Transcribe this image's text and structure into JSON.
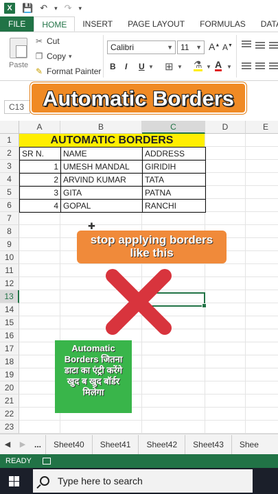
{
  "app": {
    "logo": "X",
    "tabs": [
      "FILE",
      "HOME",
      "INSERT",
      "PAGE LAYOUT",
      "FORMULAS",
      "DATA"
    ]
  },
  "ribbon": {
    "paste_label": "Paste",
    "cut_label": "Cut",
    "copy_label": "Copy",
    "format_painter_label": "Format Painter",
    "font_name": "Calibri",
    "font_size": "11",
    "bold": "B",
    "italic": "I",
    "underline": "U"
  },
  "formula_bar": {
    "name_box": "C13"
  },
  "overlay": {
    "banner": "Automatic Borders",
    "bubble_line1": "stop applying borders",
    "bubble_line2": "like this",
    "hindi_lines": [
      "Automatic",
      "Borders जितना",
      "डाटा का एंट्री करेंगे",
      "खुद ब खुद बॉर्डर",
      "मिलेगा"
    ]
  },
  "sheet": {
    "columns": [
      "A",
      "B",
      "C",
      "D",
      "E"
    ],
    "selected_column": "C",
    "rows": [
      "1",
      "2",
      "3",
      "4",
      "5",
      "6",
      "7",
      "8",
      "9",
      "10",
      "11",
      "12",
      "13",
      "14",
      "15",
      "16",
      "17",
      "18",
      "19",
      "20",
      "21",
      "22",
      "23"
    ],
    "selected_row": "13",
    "title": "AUTOMATIC BORDERS",
    "headers": [
      "SR N.",
      "NAME",
      "ADDRESS"
    ],
    "data": [
      {
        "sr": "1",
        "name": "UMESH MANDAL",
        "address": "GIRIDIH"
      },
      {
        "sr": "2",
        "name": "ARVIND KUMAR",
        "address": "TATA"
      },
      {
        "sr": "3",
        "name": "GITA",
        "address": "PATNA"
      },
      {
        "sr": "4",
        "name": "GOPAL",
        "address": "RANCHI"
      }
    ]
  },
  "sheet_tabs": {
    "ellipsis": "...",
    "tabs": [
      "Sheet40",
      "Sheet41",
      "Sheet42",
      "Sheet43",
      "Shee"
    ]
  },
  "status": {
    "mode": "READY"
  },
  "taskbar": {
    "search_placeholder": "Type here to search"
  },
  "colors": {
    "excel_green": "#217346",
    "banner_orange": "#f08a24",
    "title_yellow": "#ffee00",
    "bubble_green": "#39b54a",
    "x_red": "#d8343d"
  }
}
